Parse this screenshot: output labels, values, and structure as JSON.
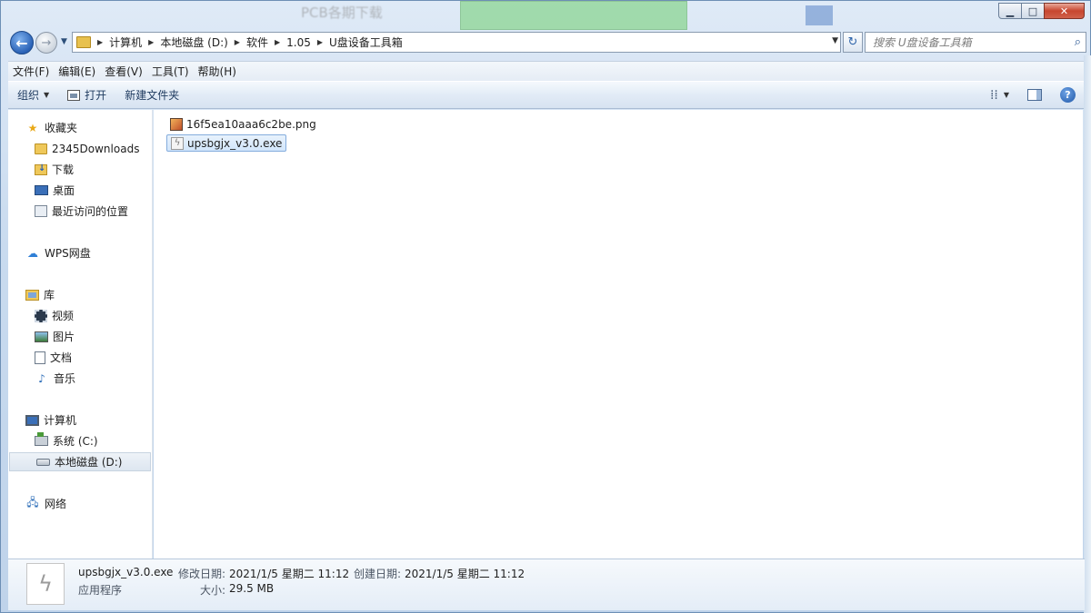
{
  "window": {
    "background_blur_text": "PCB各期下载",
    "controls": {
      "minimize": "▁",
      "maximize": "□",
      "close": "✕"
    }
  },
  "address": {
    "crumbs": [
      "计算机",
      "本地磁盘 (D:)",
      "软件",
      "1.05",
      "U盘设备工具箱"
    ],
    "search_placeholder": "搜索 U盘设备工具箱"
  },
  "menu": {
    "items": [
      "文件(F)",
      "编辑(E)",
      "查看(V)",
      "工具(T)",
      "帮助(H)"
    ]
  },
  "toolbar": {
    "organize": "组织",
    "open": "打开",
    "new_folder": "新建文件夹"
  },
  "nav": {
    "favorites": "收藏夹",
    "fav_items": [
      "2345Downloads",
      "下载",
      "桌面",
      "最近访问的位置"
    ],
    "wps": "WPS网盘",
    "libraries": "库",
    "lib_items": [
      "视频",
      "图片",
      "文档",
      "音乐"
    ],
    "computer": "计算机",
    "drives": [
      "系统 (C:)",
      "本地磁盘 (D:)"
    ],
    "network": "网络"
  },
  "files": [
    {
      "name": "16f5ea10aaa6c2be.png",
      "type": "png",
      "selected": false
    },
    {
      "name": "upsbgjx_v3.0.exe",
      "type": "exe",
      "selected": true
    }
  ],
  "details": {
    "name": "upsbgjx_v3.0.exe",
    "type": "应用程序",
    "modified_label": "修改日期:",
    "modified_value": "2021/1/5 星期二 11:12",
    "created_label": "创建日期:",
    "created_value": "2021/1/5 星期二 11:12",
    "size_label": "大小:",
    "size_value": "29.5 MB"
  },
  "colors": {
    "accent": "#2a62b6",
    "selection": "#d2e6fb",
    "chrome": "#c9dbef"
  }
}
